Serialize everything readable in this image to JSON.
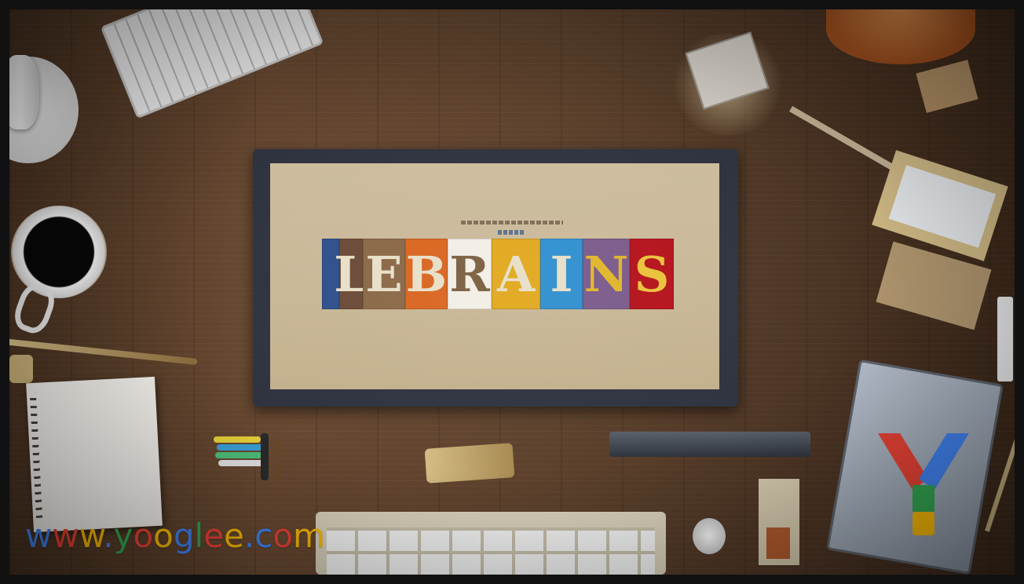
{
  "scene": {
    "description_tag": "photo",
    "screen": {
      "tiles": [
        {
          "char": "",
          "color": "#2f4f8c"
        },
        {
          "char": "L",
          "color": "#6b4b37"
        },
        {
          "char": "E",
          "color": "#8a6846"
        },
        {
          "char": "B",
          "color": "#d9651f"
        },
        {
          "char": "R",
          "color": "#f2eee6"
        },
        {
          "char": "A",
          "color": "#e1a81e"
        },
        {
          "char": "I",
          "color": "#2f8fcf"
        },
        {
          "char": "N",
          "color": "#7a5a8a"
        },
        {
          "char": "S",
          "color": "#b5121b"
        }
      ]
    },
    "watermark": {
      "letters": [
        {
          "ch": "w",
          "color": "#4285F4"
        },
        {
          "ch": "w",
          "color": "#EA4335"
        },
        {
          "ch": "w",
          "color": "#FBBC05"
        },
        {
          "ch": ".",
          "color": "#4285F4"
        },
        {
          "ch": "y",
          "color": "#34A853"
        },
        {
          "ch": "o",
          "color": "#EA4335"
        },
        {
          "ch": "o",
          "color": "#FBBC05"
        },
        {
          "ch": "g",
          "color": "#4285F4"
        },
        {
          "ch": "l",
          "color": "#34A853"
        },
        {
          "ch": "e",
          "color": "#EA4335"
        },
        {
          "ch": "e",
          "color": "#FBBC05"
        },
        {
          "ch": ".",
          "color": "#4285F4"
        },
        {
          "ch": "c",
          "color": "#4285F4"
        },
        {
          "ch": "o",
          "color": "#EA4335"
        },
        {
          "ch": "m",
          "color": "#FBBC05"
        }
      ]
    },
    "logo_colors": {
      "red": "#EA4335",
      "blue": "#4285F4",
      "green": "#34A853",
      "yellow": "#FBBC05"
    }
  }
}
